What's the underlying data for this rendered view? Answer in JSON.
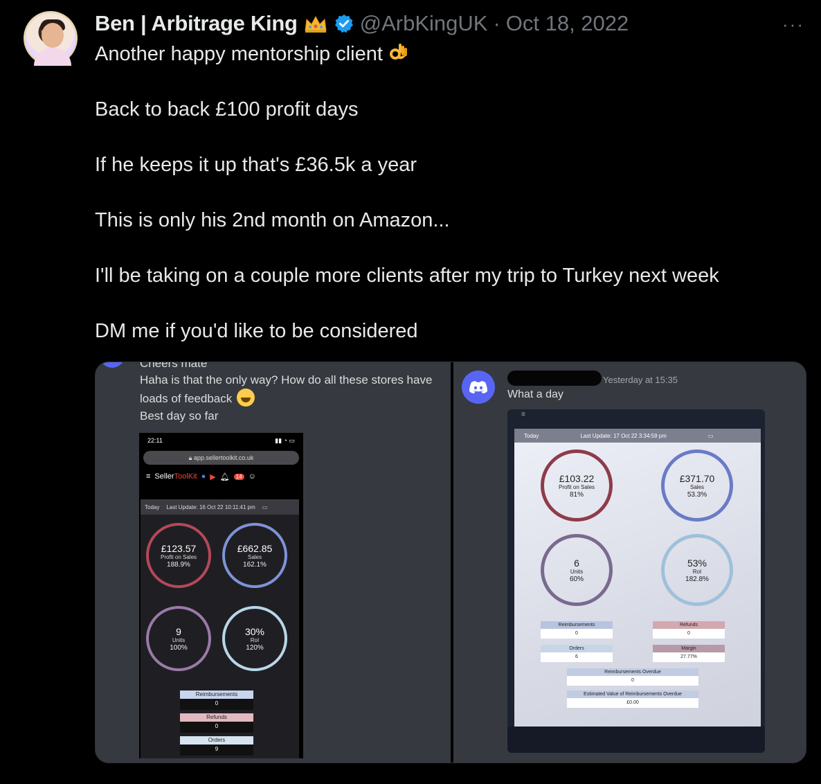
{
  "tweet": {
    "author_name": "Ben | Arbitrage King",
    "handle": "@ArbKingUK",
    "separator": "·",
    "date": "Oct 18, 2022",
    "more": "···",
    "lines": [
      "Another happy mentorship client",
      "Back to back £100 profit days",
      "If he keeps it up that's £36.5k a year",
      "This is only his 2nd month on Amazon...",
      "I'll be taking on a couple more clients after my trip to Turkey next week",
      "DM me if you'd like to be considered"
    ]
  },
  "left_shot": {
    "cut_text": "Cheers mate",
    "msg1": "Haha is that the only way? How do all these stores have",
    "msg2": "loads of feedback",
    "msg3": "Best day so far",
    "phone_time": "22:11",
    "url": "app.sellertoolkit.co.uk",
    "brand_a": "Seller",
    "brand_b": "ToolKit",
    "badge_count": "14",
    "today": "Today",
    "last_update": "Last Update: 16 Oct 22 10:11:41 pm",
    "rings": [
      {
        "value": "£123.57",
        "label": "Profit on Sales",
        "pct": "188.9%"
      },
      {
        "value": "£662.85",
        "label": "Sales",
        "pct": "162.1%"
      },
      {
        "value": "9",
        "label": "Units",
        "pct": "100%"
      },
      {
        "value": "30%",
        "label": "RoI",
        "pct": "120%"
      }
    ],
    "pills": [
      {
        "label": "Reimbursements",
        "value": "0"
      },
      {
        "label": "Refunds",
        "value": "0"
      },
      {
        "label": "Orders",
        "value": "9"
      }
    ]
  },
  "right_shot": {
    "time": "Yesterday at 15:35",
    "message": "What a day",
    "today": "Today",
    "last_update": "Last Update: 17 Oct 22 3:34:59 pm",
    "rings": [
      {
        "value": "£103.22",
        "label": "Profit on Sales",
        "pct": "81%"
      },
      {
        "value": "£371.70",
        "label": "Sales",
        "pct": "53.3%"
      },
      {
        "value": "6",
        "label": "Units",
        "pct": "60%"
      },
      {
        "value": "53%",
        "label": "RoI",
        "pct": "182.8%"
      }
    ],
    "tags": [
      {
        "label": "Reimbursements",
        "value": "0"
      },
      {
        "label": "Refunds",
        "value": "0"
      },
      {
        "label": "Orders",
        "value": "6"
      },
      {
        "label": "Margin",
        "value": "27.77%"
      },
      {
        "label": "Reimbursements Overdue",
        "value": "0"
      },
      {
        "label": "Estimated Value of Reimbursements Overdue",
        "value": "£0.00"
      }
    ]
  },
  "colors": {
    "accent_verified": "#1d9bf0",
    "discord": "#5865f2",
    "ring_profit": "#b5485a",
    "ring_sales": "#7f93d9",
    "ring_units": "#9a7aa8",
    "ring_roi": "#b9d6ea"
  }
}
